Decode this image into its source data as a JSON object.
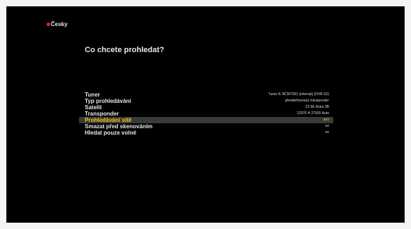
{
  "header": {
    "language": "Česky"
  },
  "page": {
    "title": "Co chcete prohledat?"
  },
  "settings": [
    {
      "label": "Tuner",
      "value": "Tuner A: BCM7362 (internal) (DVB-S2)"
    },
    {
      "label": "Typ prohledávání",
      "value": "předdefinovaný transponder"
    },
    {
      "label": "Satelit",
      "value": "23.5E Astra 3B"
    },
    {
      "label": "Transponder",
      "value": "12070 H 27500 Auto"
    },
    {
      "label": "Prohledávání sítě",
      "value": "ano"
    },
    {
      "label": "Smazat před skenováním",
      "value": "ne"
    },
    {
      "label": "Hledat pouze volné",
      "value": "ne"
    }
  ],
  "selected_index": 4,
  "colors": {
    "highlight_text": "#f2c81a",
    "highlight_bar": "#3a3a3a",
    "language_icon": "#d8262b"
  }
}
